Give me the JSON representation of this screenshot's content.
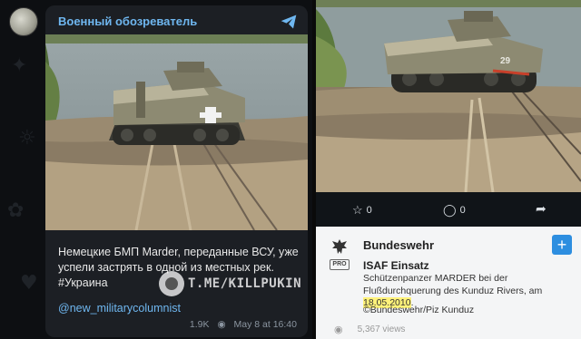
{
  "telegram": {
    "channel_name": "Военный обозреватель",
    "icons": {
      "share": "telegram-share-icon",
      "avatar": "channel-avatar"
    },
    "post_text": "Немецкие БМП Marder, переданные ВСУ, уже успели застрять в одной из местных рек. #Украина",
    "link": "@new_military​columnist",
    "views": "1.9K",
    "date": "May 8 at 16:40",
    "colors": {
      "bg": "#0d0f12",
      "card": "#1c1f24",
      "accent": "#6fb7f0"
    }
  },
  "watermark": {
    "text": "T.ME/KILLPUKIN"
  },
  "bundeswehr": {
    "likes": "0",
    "comments": "0",
    "account_name": "Bundeswehr",
    "pro_badge": "PRO",
    "post_title": "ISAF Einsatz",
    "desc_before": "Schützenpanzer MARDER bei der Flußdurchquerung des Kunduz Rivers, am ",
    "desc_date": "18.05.2010",
    "desc_after": ".",
    "credit": "©Bundeswehr/Piz Kunduz",
    "views": "5,367 views",
    "colors": {
      "accent": "#2d8ee0",
      "highlight": "#fff27a"
    }
  }
}
